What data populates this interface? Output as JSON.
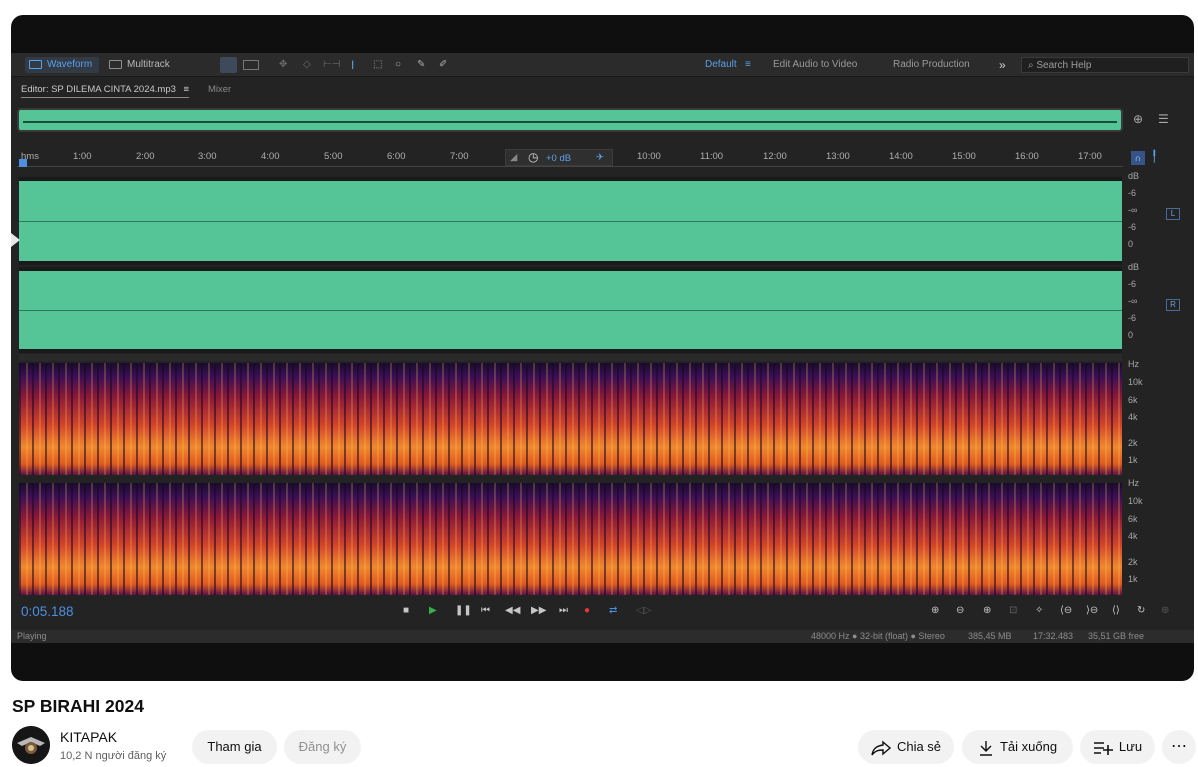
{
  "toolbar": {
    "waveform": "Waveform",
    "multitrack": "Multitrack",
    "workspaces": [
      "Default",
      "Edit Audio to Video",
      "Radio Production"
    ],
    "more": "»",
    "search_placeholder": "Search Help"
  },
  "editor": {
    "tab": "Editor: SP DILEMA CINTA 2024.mp3",
    "menu_glyph": "≡",
    "mixer": "Mixer"
  },
  "ruler": {
    "labels": [
      "hms",
      "1:00",
      "2:00",
      "3:00",
      "4:00",
      "5:00",
      "6:00",
      "7:00",
      "10:00",
      "11:00",
      "12:00",
      "13:00",
      "14:00",
      "15:00",
      "16:00",
      "17:00"
    ],
    "gain": "+0 dB"
  },
  "db_scale": [
    "dB",
    "-6",
    "-∞",
    "-6",
    "0"
  ],
  "channels": {
    "left": "L",
    "right": "R"
  },
  "hz_scale": [
    "Hz",
    "10k",
    "6k",
    "4k",
    "2k",
    "1k"
  ],
  "transport": {
    "time": "0:05.188"
  },
  "status": {
    "state": "Playing",
    "format": "48000 Hz ● 32-bit (float) ● Stereo",
    "size": "385,45 MB",
    "duration": "17:32.483",
    "free": "35,51 GB free"
  },
  "video": {
    "title": "SP BIRAHI 2024"
  },
  "channel": {
    "name": "KITAPAK",
    "subscribers": "10,2 N người đăng ký"
  },
  "actions": {
    "join": "Tham gia",
    "subscribe": "Đăng ký",
    "share": "Chia sẻ",
    "download": "Tải xuống",
    "save": "Lưu",
    "more": "⋯"
  },
  "colors": {
    "waveform": "#55c496",
    "accent_time": "#4d8fe0",
    "record": "#e03a3a",
    "play": "#35b04a"
  }
}
